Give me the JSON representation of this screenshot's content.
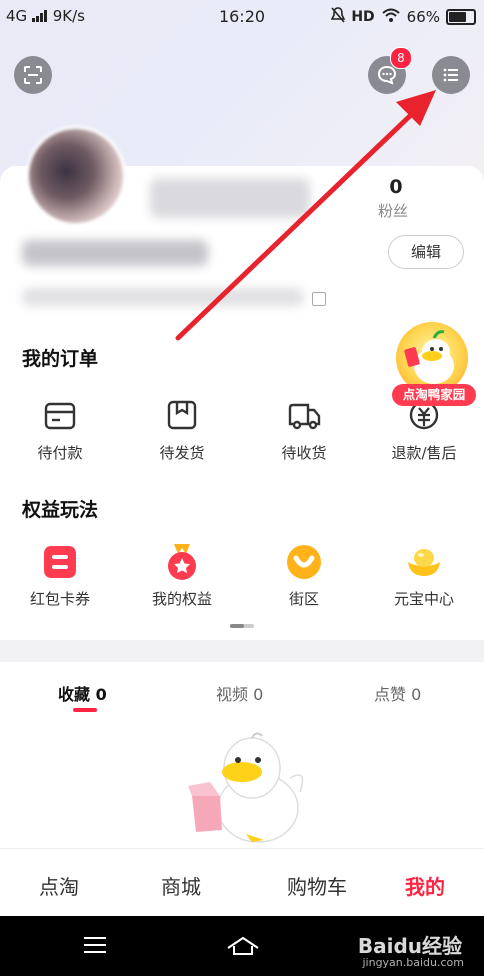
{
  "status_bar": {
    "network": "4G",
    "speed": "9K/s",
    "time": "16:20",
    "hd": "HD",
    "battery": "66%"
  },
  "header": {
    "message_badge": "8"
  },
  "profile": {
    "fans_count": "0",
    "fans_label": "粉丝",
    "edit_label": "编辑"
  },
  "orders": {
    "title": "我的订单",
    "items": [
      {
        "label": "待付款",
        "icon": "wallet-icon"
      },
      {
        "label": "待发货",
        "icon": "package-icon"
      },
      {
        "label": "待收货",
        "icon": "truck-icon"
      },
      {
        "label": "退款/售后",
        "icon": "refund-icon"
      }
    ],
    "promo_banner": "点淘鸭家园"
  },
  "benefits": {
    "title": "权益玩法",
    "items": [
      {
        "label": "红包卡券",
        "icon": "coupon-icon",
        "color": "#ff3b4f"
      },
      {
        "label": "我的权益",
        "icon": "medal-icon",
        "color": "#ff3b4f"
      },
      {
        "label": "街区",
        "icon": "street-icon",
        "color": "#ffb21a"
      },
      {
        "label": "元宝中心",
        "icon": "ingot-icon",
        "color": "#ffc21a"
      }
    ]
  },
  "tabs": [
    {
      "label": "收藏",
      "count": "0",
      "active": true
    },
    {
      "label": "视频",
      "count": "0",
      "active": false
    },
    {
      "label": "点赞",
      "count": "0",
      "active": false
    }
  ],
  "bottom_nav": [
    {
      "label": "点淘",
      "active": false
    },
    {
      "label": "商城",
      "active": false
    },
    {
      "label": "购物车",
      "active": false
    },
    {
      "label": "我的",
      "active": true
    }
  ],
  "watermark": {
    "brand": "Baidu经验",
    "url": "jingyan.baidu.com"
  },
  "colors": {
    "accent": "#ff2442",
    "annotation_arrow": "#e8232e"
  }
}
